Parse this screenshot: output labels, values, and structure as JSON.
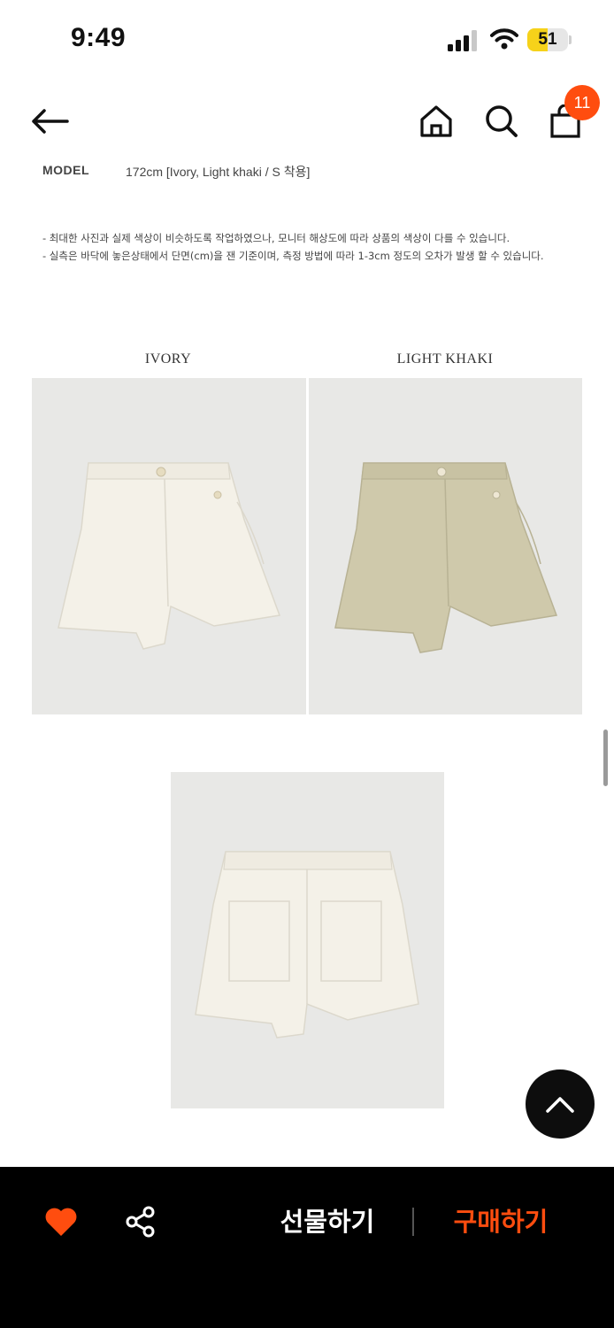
{
  "status_bar": {
    "time": "9:49",
    "battery": "51",
    "battery_level": 0.51
  },
  "header": {
    "cart_count": "11",
    "icons": [
      "back-arrow-icon",
      "home-icon",
      "search-icon",
      "shopping-bag-icon"
    ]
  },
  "model_info": {
    "label": "MODEL",
    "value": "172cm [Ivory, Light khaki / S 착용]"
  },
  "notes": [
    "- 최대한 사진과 실제 색상이 비슷하도록 작업하였으나, 모니터 해상도에 따라 상품의 색상이 다를 수 있습니다.",
    "- 실측은 바닥에 놓은상태에서 단면(cm)을 잰 기준이며, 측정 방법에 따라 1-3cm 정도의 오차가 발생 할 수 있습니다."
  ],
  "colors": [
    {
      "label": "IVORY",
      "swatch": "#f4f1e8"
    },
    {
      "label": "LIGHT KHAKI",
      "swatch": "#cfc9ab"
    }
  ],
  "bottom_bar": {
    "gift_label": "선물하기",
    "buy_label": "구매하기",
    "accent": "#ff4d0f",
    "like_color": "#ff4d0f"
  }
}
